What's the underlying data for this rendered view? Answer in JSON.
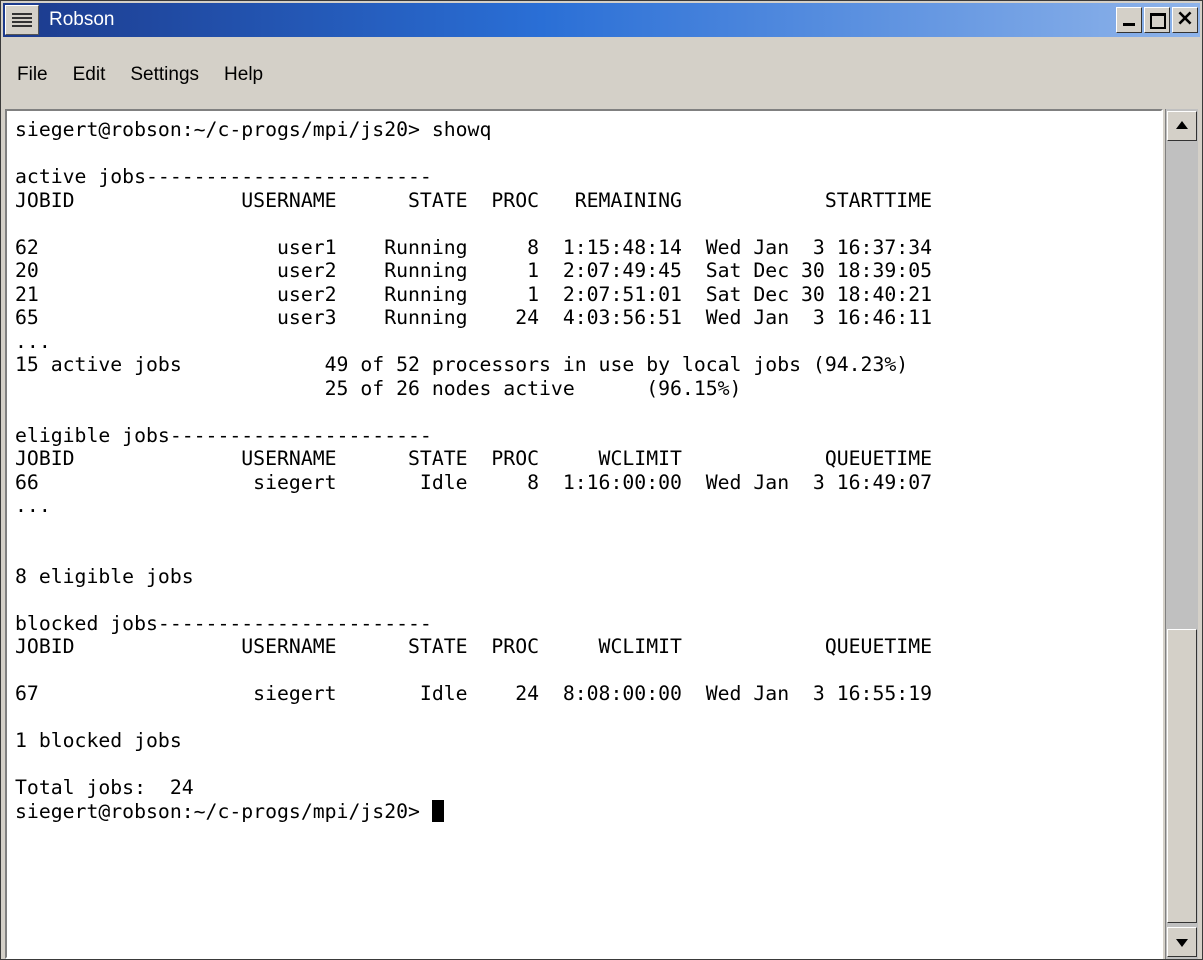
{
  "window": {
    "title": "Robson",
    "minimize": "_",
    "maximize": "□",
    "close": "×"
  },
  "menubar": {
    "items": [
      "File",
      "Edit",
      "Settings",
      "Help"
    ]
  },
  "terminal": {
    "lines": [
      "siegert@robson:~/c-progs/mpi/js20> showq",
      "",
      "active jobs------------------------",
      "JOBID              USERNAME      STATE  PROC   REMAINING            STARTTIME",
      "",
      "62                    user1    Running     8  1:15:48:14  Wed Jan  3 16:37:34",
      "20                    user2    Running     1  2:07:49:45  Sat Dec 30 18:39:05",
      "21                    user2    Running     1  2:07:51:01  Sat Dec 30 18:40:21",
      "65                    user3    Running    24  4:03:56:51  Wed Jan  3 16:46:11",
      "...",
      "15 active jobs            49 of 52 processors in use by local jobs (94.23%)",
      "                          25 of 26 nodes active      (96.15%)",
      "",
      "eligible jobs----------------------",
      "JOBID              USERNAME      STATE  PROC     WCLIMIT            QUEUETIME",
      "66                  siegert       Idle     8  1:16:00:00  Wed Jan  3 16:49:07",
      "...",
      "",
      "",
      "8 eligible jobs",
      "",
      "blocked jobs-----------------------",
      "JOBID              USERNAME      STATE  PROC     WCLIMIT            QUEUETIME",
      "",
      "67                  siegert       Idle    24  8:08:00:00  Wed Jan  3 16:55:19",
      "",
      "1 blocked jobs",
      "",
      "Total jobs:  24"
    ],
    "prompt": "siegert@robson:~/c-progs/mpi/js20> "
  },
  "colors": {
    "titlebar_start": "#1c3a8c",
    "titlebar_end": "#8fb4ea",
    "background": "#f7b640"
  }
}
